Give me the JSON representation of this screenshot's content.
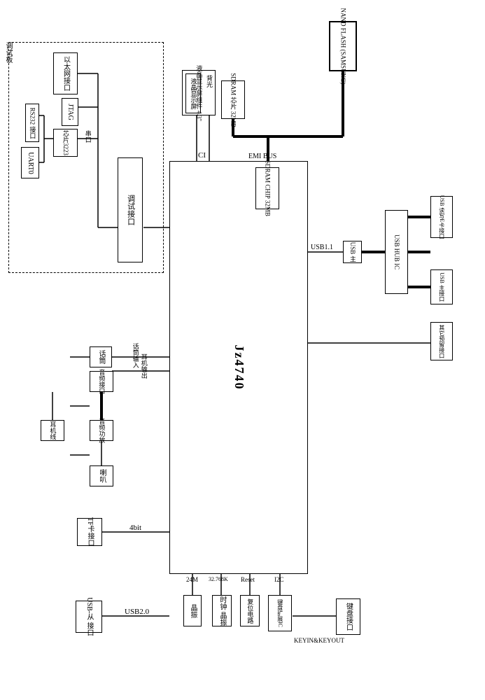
{
  "diagram": {
    "cpu": "Jz4740",
    "memory": {
      "nand": "NAND FLASH\n(SAMSUNG)",
      "sdram1": "SDRAM 芯片\n32MB",
      "sdram2": "SDRAM CHIP\n32MB",
      "bus": "EMI BUS"
    },
    "lcd": {
      "assembly": "液晶显示屏组件 4.3\"",
      "backlight": "背光",
      "panel": "液晶显示屏",
      "iface": "CI"
    },
    "debug_group": {
      "title": "调试板",
      "debug_port": "调试接口",
      "eth": "以太网接口",
      "jtag": "JTAG",
      "chip3223": "芯片3223",
      "rs232": "RS232 接口",
      "uart": "UART0",
      "serial": "串口"
    },
    "audio": {
      "mic": "话筒",
      "iface": "音频接口",
      "amp": "音频功放",
      "speaker": "喇叭",
      "earphone": "耳机线",
      "hp_in": "话筒输入",
      "hp_out": "耳机输出"
    },
    "storage": {
      "tf": "TF卡接口",
      "tf_bus": "4bit"
    },
    "usb": {
      "slave": "USB-从\n接口",
      "slave_bus": "USB2.0",
      "host_bus": "USB1.1",
      "host": "USB 主",
      "hub": "USB HUB IC",
      "reader": "USB 读写E卡接口",
      "host_port": "USB 主接口",
      "other": "其它预留接口"
    },
    "sys": {
      "xtal_24m": "晶振",
      "clk_24m": "24M",
      "rtc_xtal": "时钟\n晶振",
      "clk_rtc": "32.768K",
      "reset_ck": "复位电路",
      "reset": "Reset",
      "kbd_ext": "键盘扩展IC",
      "i2c": "I2C",
      "kbd_if": "键盘接口",
      "key_bus": "KEYIN&KEYOUT"
    }
  }
}
